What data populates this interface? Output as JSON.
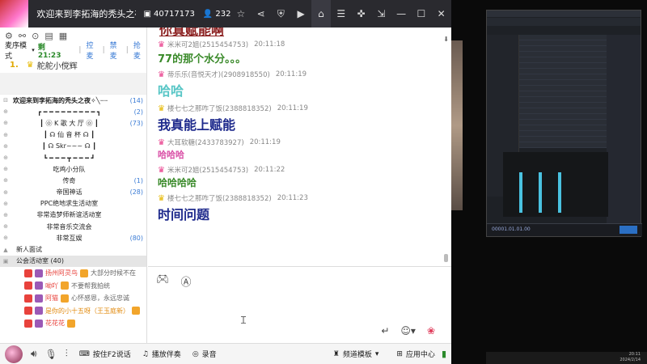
{
  "titlebar": {
    "title": "欢迎来到李拓海的秃头之夜丶..",
    "channel_id": "40717173",
    "online_count": "232",
    "accent": "#2a2a2f"
  },
  "left": {
    "mode_label": "麦序模式",
    "mode_time": "剩 21:23",
    "mode_actions": [
      "控麦",
      "禁麦",
      "抢麦"
    ],
    "queue": [
      {
        "num": "1.",
        "name": "舵舵小傥辉"
      }
    ],
    "channels": [
      {
        "pre": "⊟",
        "name": "欢迎来到李拓海的秃头之夜✧╲┈┈",
        "count": "(14)",
        "type": "root"
      },
      {
        "pre": "⊕",
        "name": "┏ ━ ━ ━ ━ ━ ━ ━ ━ ━ ┓",
        "count": "(2)",
        "type": "item"
      },
      {
        "pre": "⊕",
        "name": "┃ ㉧ K 歌 大 厅 ㉧ ┃",
        "count": "(73)",
        "type": "item"
      },
      {
        "pre": "⊕",
        "name": "┃ ☊   仙 音 杯   ☊ ┃",
        "count": "",
        "type": "item"
      },
      {
        "pre": "⊕",
        "name": "┃ ☊   Skr~~~   ☊ ┃",
        "count": "",
        "type": "item"
      },
      {
        "pre": "⊕",
        "name": "┗ ━ ━ ━ ┳ ━ ━ ━ ┛",
        "count": "",
        "type": "item"
      },
      {
        "pre": "⊕",
        "name": "吃鸡小分队",
        "count": "",
        "type": "item"
      },
      {
        "pre": "⊕",
        "name": "传奇",
        "count": "(1)",
        "type": "item"
      },
      {
        "pre": "⊕",
        "name": "帝国神话",
        "count": "(28)",
        "type": "item"
      },
      {
        "pre": "⊕",
        "name": "PPC绝地求生活动室",
        "count": "",
        "type": "item"
      },
      {
        "pre": "⊕",
        "name": "非常造梦师新谊活动室",
        "count": "",
        "type": "item"
      },
      {
        "pre": "⊕",
        "name": "非常音乐交流会",
        "count": "",
        "type": "item"
      },
      {
        "pre": "⊕",
        "name": "非常互娱",
        "count": "(80)",
        "type": "item"
      },
      {
        "pre": "▲",
        "name": "新人面试",
        "count": "",
        "type": "sub"
      },
      {
        "pre": "▣",
        "name": "公会活动室 (40)",
        "count": "",
        "type": "active"
      }
    ],
    "users": [
      {
        "name": "扬州阿灵鸟",
        "msg": "大部分时候不在",
        "color": "r"
      },
      {
        "name": "呦吖",
        "msg": "不要帮我拍统",
        "color": "r"
      },
      {
        "name": "阿猫",
        "msg": "心怀感恩，永远忠诚",
        "color": "r"
      },
      {
        "name": "是你的小十五呀（王玉庭新）",
        "msg": "",
        "color": "o"
      },
      {
        "name": "花花花",
        "msg": "",
        "color": "r"
      }
    ]
  },
  "chat": {
    "top_cut": "你真赋能啊",
    "messages": [
      {
        "sender": "米米可2姐(2515454753)",
        "time": "20:11:18",
        "body": "77的那个水分。。。",
        "crown": "p",
        "color": "#3a8a2a",
        "size": "13px"
      },
      {
        "sender": "蒂乐乐(音悦天才)(2908918550)",
        "time": "20:11:19",
        "body": "哈哈",
        "crown": "p",
        "color": "#58c6c6",
        "size": "16px"
      },
      {
        "sender": "楼七七之那咋了饭(2388818352)",
        "time": "20:11:19",
        "body": "我真能上赋能",
        "crown": "y",
        "color": "#1e2a8c",
        "size": "16px"
      },
      {
        "sender": "大耳软糖(2433783927)",
        "time": "20:11:19",
        "body": "哈哈哈",
        "crown": "p",
        "color": "#d94fa6",
        "size": "11px"
      },
      {
        "sender": "米米可2姐(2515454753)",
        "time": "20:11:22",
        "body": "哈哈哈哈",
        "crown": "p",
        "color": "#3a8a2a",
        "size": "12px"
      },
      {
        "sender": "楼七七之那咋了饭(2388818352)",
        "time": "20:11:23",
        "body": "时间问题",
        "crown": "y",
        "color": "#1e2a8c",
        "size": "16px"
      }
    ]
  },
  "bottombar": {
    "ptt_label": "按住F2说话",
    "accomp_label": "播放伴奏",
    "record_label": "录音",
    "template_label": "频道模板",
    "apps_label": "应用中心"
  },
  "daw": {
    "timecode": "00001.01.01.00"
  },
  "taskbar": {
    "clock": "20:11",
    "date": "2024/2/14"
  }
}
